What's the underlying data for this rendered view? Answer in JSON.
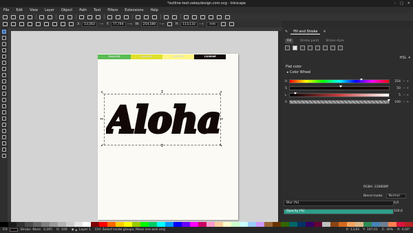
{
  "window": {
    "title": "*outline-text-zakeydesign.com.svg - Inkscape"
  },
  "menu": [
    "File",
    "Edit",
    "View",
    "Layer",
    "Object",
    "Path",
    "Text",
    "Filters",
    "Extensions",
    "Help"
  ],
  "tool_controls": {
    "x_label": "X:",
    "x_value": "13,563",
    "y_label": "Y:",
    "y_value": "77,744",
    "w_label": "W:",
    "w_value": "254,580",
    "h_label": "H:",
    "h_value": "113,132",
    "unit": "mm"
  },
  "page_swatches": [
    {
      "label": "5bbc54ff",
      "color": "#5bbc54"
    },
    {
      "label": "e0e02cff",
      "color": "#e0e02c"
    },
    {
      "label": "fdf585ff",
      "color": "#fdf585"
    },
    {
      "label": "120808ff",
      "color": "#120808"
    }
  ],
  "artwork": {
    "text": "Aloha",
    "fill": "#120808"
  },
  "panel": {
    "tabs": [
      "Fill and Stroke"
    ],
    "subtabs": [
      "Fill",
      "Stroke paint",
      "Stroke style"
    ],
    "mode": "HSL",
    "flat_label": "Flat color",
    "wheel_label": "Color Wheel",
    "sliders": [
      {
        "label": "H",
        "value": "254"
      },
      {
        "label": "S",
        "value": "50"
      },
      {
        "label": "L",
        "value": "5"
      },
      {
        "label": "A",
        "value": "100"
      }
    ],
    "rgba_label": "RGBA:",
    "rgba_value": "120808ff",
    "blend_label": "Blend mode:",
    "blend_value": "Normal",
    "blur_label": "Blur (%)",
    "blur_value": "0,0",
    "opacity_label": "Opacity (%)",
    "opacity_value": "100,0"
  },
  "status": {
    "fill_label": "Fill:",
    "stroke_label": "Stroke:",
    "stroke_value": "None",
    "stroke_width": "0,265",
    "opacity_label": "O:",
    "opacity_value": "100",
    "layer": "Layer 1",
    "message": "Ctrl: Select inside groups, Move one axis only",
    "x_label": "X:",
    "x_value": "13,65",
    "y_label": "Y:",
    "y_value": "107,01",
    "zoom_label": "Z:",
    "zoom_value": "30%",
    "rotation_label": "R:",
    "rotation_value": "0,00°"
  },
  "palette": [
    "#000000",
    "#1a1a1a",
    "#333333",
    "#4d4d4d",
    "#666666",
    "#808080",
    "#999999",
    "#b3b3b3",
    "#cccccc",
    "#e6e6e6",
    "#ffffff",
    "#800000",
    "#ff0000",
    "#ff6600",
    "#ffcc00",
    "#ffff00",
    "#99cc00",
    "#00ff00",
    "#00cc66",
    "#00ffff",
    "#0099ff",
    "#0000ff",
    "#6600ff",
    "#ff00ff",
    "#cc0066",
    "#ff99cc",
    "#ffcc99",
    "#ffffcc",
    "#ccffcc",
    "#ccffff",
    "#99ccff",
    "#cc99ff",
    "#996633",
    "#663300",
    "#336600",
    "#006666",
    "#003366",
    "#330066",
    "#660033",
    "#c0c0c0",
    "#8b4513",
    "#d2691e",
    "#f4a460",
    "#deb887",
    "#2e8b57",
    "#4682b4",
    "#708090",
    "#ff7f50",
    "#dc143c",
    "#b22222"
  ]
}
